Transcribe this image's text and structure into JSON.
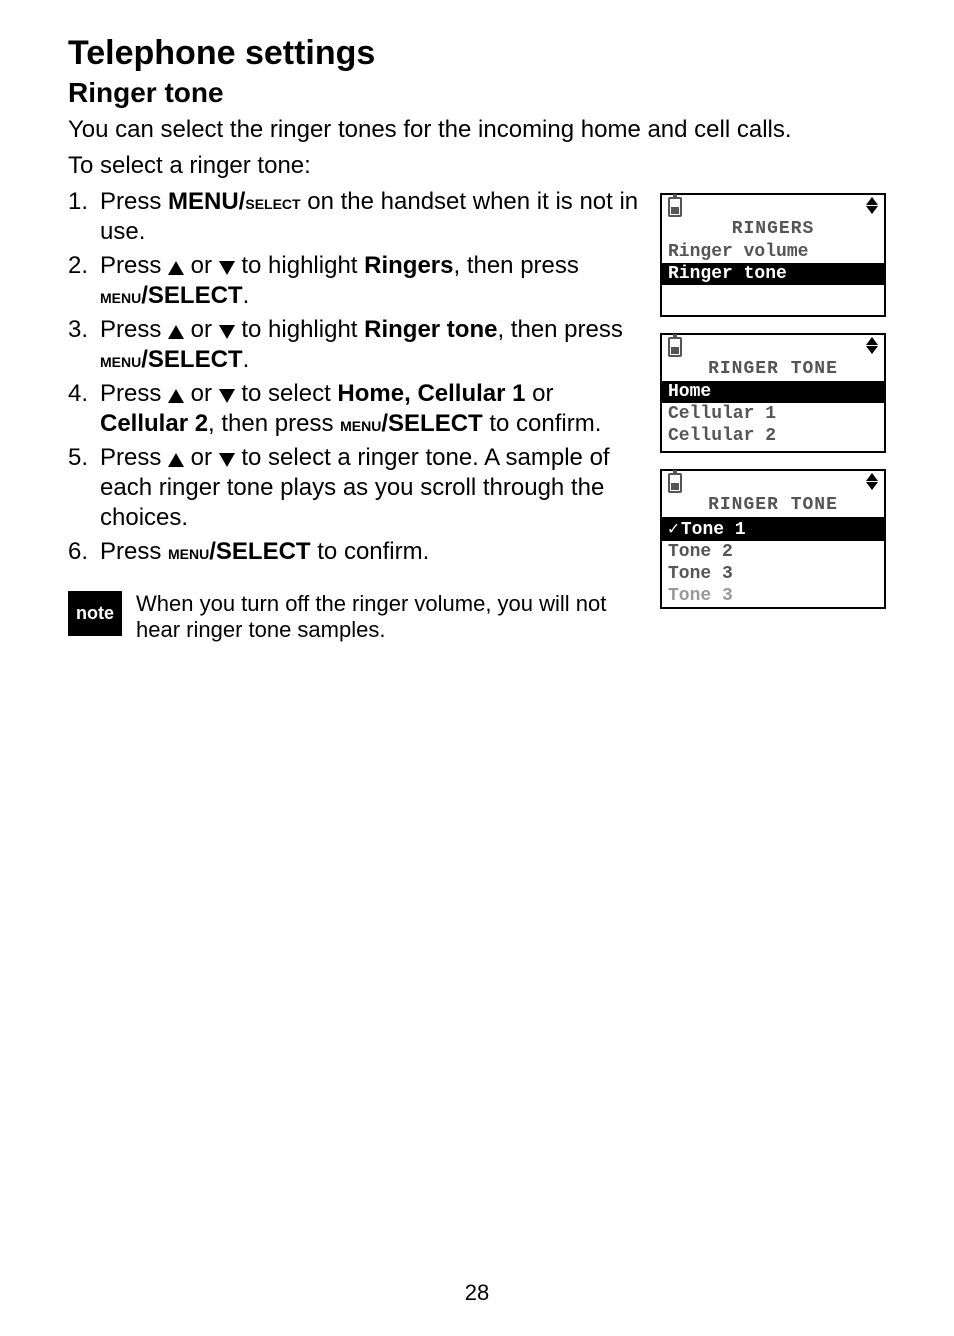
{
  "page": {
    "h1": "Telephone settings",
    "h2": "Ringer tone",
    "intro1": "You can select the ringer tones for the incoming home and cell calls.",
    "intro2": "To select a ringer tone:",
    "number": "28"
  },
  "steps": [
    {
      "num": "1.",
      "pre": "Press ",
      "key": "MENU/",
      "keysc": "select",
      "post": " on the handset when it is not in use."
    },
    {
      "num": "2.",
      "pre": "Press ",
      "mid": " or ",
      "post1": " to highlight ",
      "bold": "Ringers",
      "post2": ", then press ",
      "key2a": "menu",
      "key2b": "/SELECT",
      "end": "."
    },
    {
      "num": "3.",
      "pre": "Press ",
      "mid": " or ",
      "post1": " to highlight ",
      "bold": "Ringer tone",
      "post2": ", then press ",
      "key2a": "menu",
      "key2b": "/SELECT",
      "end": "."
    },
    {
      "num": "4.",
      "pre": "Press ",
      "mid": " or ",
      "post1": " to select ",
      "bold": "Home, Cellular 1",
      "post2": " or ",
      "bold2": "Cellular 2",
      "post3": ", then press ",
      "key2a": "menu",
      "key2b": "/SELECT",
      "end": " to confirm."
    },
    {
      "num": "5.",
      "pre": "Press ",
      "mid": " or ",
      "post1": " to select a ringer tone. A sample of each ringer tone plays as you scroll through the choices."
    },
    {
      "num": "6.",
      "pre": "Press ",
      "key2a": "menu",
      "key2b": "/SELECT",
      "end": " to confirm."
    }
  ],
  "note": {
    "badge": "note",
    "text": "When you turn off the ringer volume, you will not hear ringer tone samples."
  },
  "lcd1": {
    "title": "RINGERS",
    "row1": "Ringer volume",
    "row2": "Ringer tone"
  },
  "lcd2": {
    "title": "RINGER TONE",
    "row1": "Home",
    "row2": "Cellular 1",
    "row3": "Cellular 2"
  },
  "lcd3": {
    "title": "RINGER TONE",
    "row1": "Tone 1",
    "row2": " Tone 2",
    "row3": " Tone 3",
    "row4": " Tone 3"
  }
}
